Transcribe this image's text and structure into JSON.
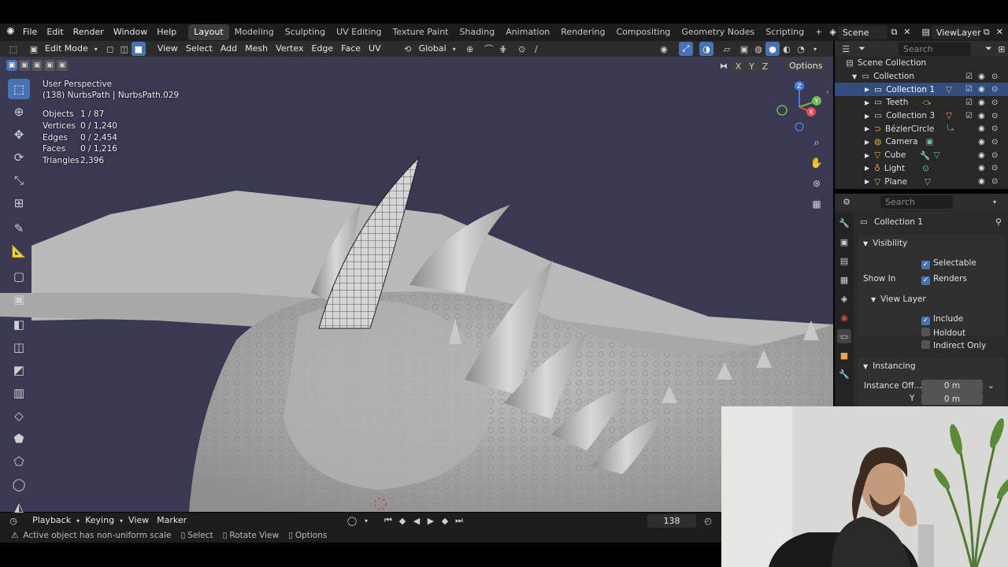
{
  "menubar": {
    "items": [
      "File",
      "Edit",
      "Render",
      "Window",
      "Help"
    ],
    "workspaces": [
      "Layout",
      "Modeling",
      "Sculpting",
      "UV Editing",
      "Texture Paint",
      "Shading",
      "Animation",
      "Rendering",
      "Compositing",
      "Geometry Nodes",
      "Scripting"
    ],
    "active_workspace": "Layout",
    "add_tab": "+",
    "scene": "Scene",
    "view_layer": "ViewLayer"
  },
  "viewport_header": {
    "mode": "Edit Mode",
    "menus": [
      "View",
      "Select",
      "Add",
      "Mesh",
      "Vertex",
      "Edge",
      "Face",
      "UV"
    ],
    "transform_orientation": "Global",
    "options_label": "Options",
    "axes": [
      "X",
      "Y",
      "Z"
    ]
  },
  "overlay": {
    "perspective": "User Perspective",
    "object_name": "(138) NurbsPath | NurbsPath.029",
    "stats": [
      {
        "label": "Objects",
        "value": "1 / 87"
      },
      {
        "label": "Vertices",
        "value": "0 / 1,240"
      },
      {
        "label": "Edges",
        "value": "0 / 2,454"
      },
      {
        "label": "Faces",
        "value": "0 / 1,216"
      },
      {
        "label": "Triangles",
        "value": "2,396"
      }
    ]
  },
  "gizmo": {
    "z": "Z",
    "y": "Y",
    "x": "X"
  },
  "outliner": {
    "search_placeholder": "Search",
    "root": "Scene Collection",
    "collection": "Collection",
    "items": [
      {
        "name": "Collection 1",
        "icon": "collection-icon",
        "selected": true
      },
      {
        "name": "Teeth",
        "icon": "collection-icon",
        "selected": false
      },
      {
        "name": "Collection 3",
        "icon": "collection-icon",
        "selected": false
      },
      {
        "name": "BézierCircle",
        "icon": "curve-icon",
        "selected": false
      },
      {
        "name": "Camera",
        "icon": "camera-icon",
        "selected": false
      },
      {
        "name": "Cube",
        "icon": "mesh-icon",
        "selected": false
      },
      {
        "name": "Light",
        "icon": "light-icon",
        "selected": false
      },
      {
        "name": "Plane",
        "icon": "mesh-icon",
        "selected": false
      }
    ]
  },
  "properties": {
    "search_placeholder": "Search",
    "title": "Collection 1",
    "visibility_header": "Visibility",
    "selectable": "Selectable",
    "show_in": "Show In",
    "renders": "Renders",
    "view_layer_header": "View Layer",
    "include": "Include",
    "holdout": "Holdout",
    "indirect_only": "Indirect Only",
    "instancing_header": "Instancing",
    "instance_offset_label": "Instance Off...",
    "instance_offset_x": "0 m",
    "y_label": "Y",
    "instance_offset_y": "0 m"
  },
  "timeline": {
    "menus": [
      "Playback",
      "Keying",
      "View",
      "Marker"
    ],
    "current_frame": "138"
  },
  "statusbar": {
    "warning": "Active object has non-uniform scale",
    "select": "Select",
    "rotate": "Rotate View",
    "options": "Options"
  },
  "colors": {
    "accent": "#4772b3",
    "viewport_bg": "#393954",
    "panel_bg": "#2b2b2b",
    "header_bg": "#1d1d1d"
  }
}
